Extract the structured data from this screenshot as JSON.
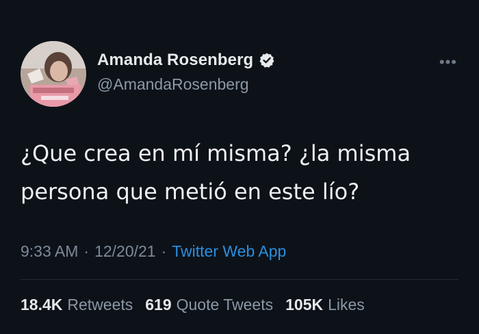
{
  "author": {
    "display_name": "Amanda Rosenberg",
    "handle": "@AmandaRosenberg",
    "verified": true
  },
  "more_label": "•••",
  "tweet": {
    "text": "¿Que crea en mí misma? ¿la misma\npersona que metió en este lío?"
  },
  "meta": {
    "time": "9:33 AM",
    "separator": "·",
    "date": "12/20/21",
    "source": "Twitter Web App"
  },
  "stats": {
    "retweets_count": "18.4K",
    "retweets_label": "Retweets",
    "quotes_count": "619",
    "quotes_label": "Quote Tweets",
    "likes_count": "105K",
    "likes_label": "Likes"
  },
  "colors": {
    "background": "#0d1219",
    "link": "#2b8fe0",
    "secondary_text": "#8b98a5"
  }
}
